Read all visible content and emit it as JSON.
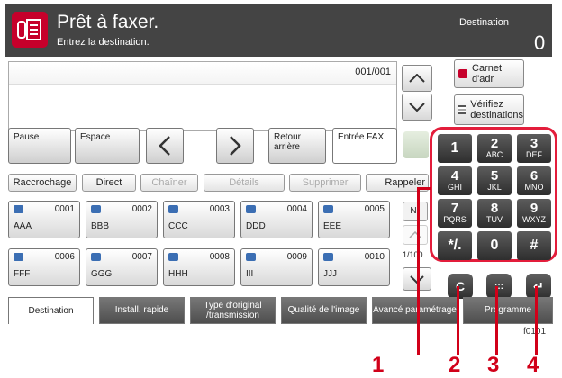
{
  "header": {
    "title": "Prêt à faxer.",
    "subtitle": "Entrez la destination.",
    "destination_label": "Destination",
    "destination_count": "0"
  },
  "dest": {
    "counter": "001/001",
    "address_book": "Carnet d'adr",
    "check_dest": "Vérifiez destinations"
  },
  "functions": {
    "pause": "Pause",
    "space": "Espace",
    "backspace": "Retour arrière",
    "fax_input": "Entrée FAX"
  },
  "tabs": {
    "hangup": "Raccrochage",
    "direct": "Direct",
    "chain": "Chaîner",
    "details": "Détails",
    "delete": "Supprimer",
    "redial": "Rappeler"
  },
  "one_touch": [
    {
      "num": "0001",
      "name": "AAA"
    },
    {
      "num": "0002",
      "name": "BBB"
    },
    {
      "num": "0003",
      "name": "CCC"
    },
    {
      "num": "0004",
      "name": "DDD"
    },
    {
      "num": "0005",
      "name": "EEE"
    },
    {
      "num": "0006",
      "name": "FFF"
    },
    {
      "num": "0007",
      "name": "GGG"
    },
    {
      "num": "0008",
      "name": "HHH"
    },
    {
      "num": "0009",
      "name": "III"
    },
    {
      "num": "0010",
      "name": "JJJ"
    }
  ],
  "paging": {
    "no_label": "N°",
    "page": "1/100"
  },
  "keypad": [
    {
      "d": "1",
      "l": ""
    },
    {
      "d": "2",
      "l": "ABC"
    },
    {
      "d": "3",
      "l": "DEF"
    },
    {
      "d": "4",
      "l": "GHI"
    },
    {
      "d": "5",
      "l": "JKL"
    },
    {
      "d": "6",
      "l": "MNO"
    },
    {
      "d": "7",
      "l": "PQRS"
    },
    {
      "d": "8",
      "l": "TUV"
    },
    {
      "d": "9",
      "l": "WXYZ"
    },
    {
      "d": "*/.",
      "l": ""
    },
    {
      "d": "0",
      "l": ""
    },
    {
      "d": "#",
      "l": ""
    }
  ],
  "hard_keys": {
    "clear": "C",
    "quick": ":::",
    "enter": "↵"
  },
  "bottom_tabs": [
    "Destination",
    "Install. rapide",
    "Type d'original /transmission",
    "Qualité de l'image",
    "Avancé paramétrage",
    "Programme"
  ],
  "figure_id": "f0101",
  "callouts": [
    "1",
    "2",
    "3",
    "4"
  ],
  "colors": {
    "header_bg": "#444444",
    "accent_red": "#e31d3b",
    "fax_icon": "#c6002b"
  }
}
